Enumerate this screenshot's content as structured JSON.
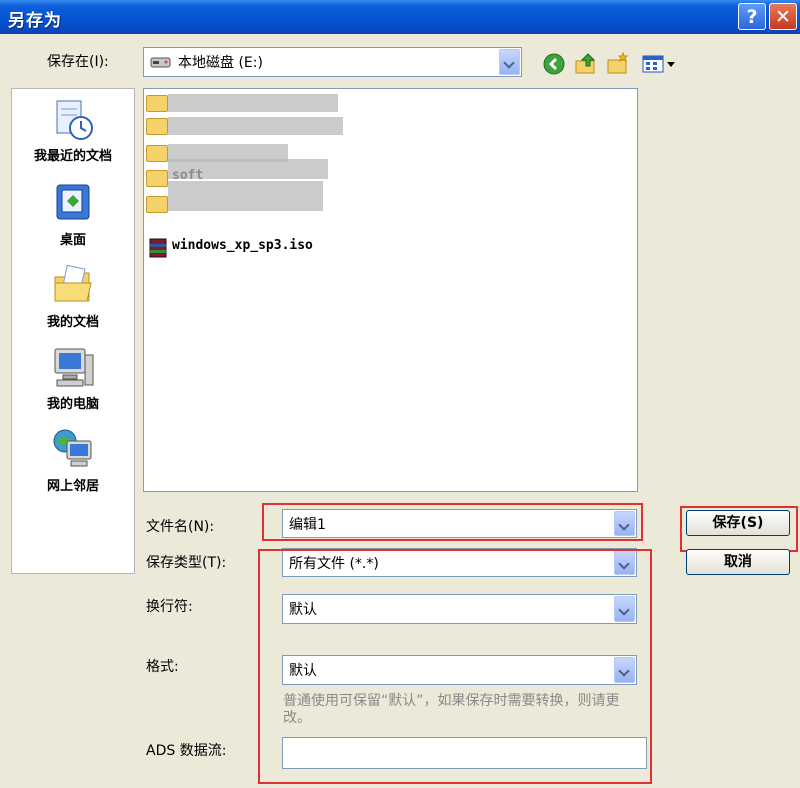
{
  "window": {
    "title": "另存为",
    "help_label": "?",
    "close_label": "✕"
  },
  "save_in": {
    "label": "保存在(I):",
    "value": "本地磁盘 (E:)"
  },
  "toolbar": {
    "icons": [
      "back-icon",
      "up-folder-icon",
      "new-folder-icon",
      "view-menu-icon"
    ]
  },
  "places": [
    {
      "label": "我最近的文档",
      "icon": "recent-documents-icon"
    },
    {
      "label": "桌面",
      "icon": "desktop-icon"
    },
    {
      "label": "我的文档",
      "icon": "my-documents-icon"
    },
    {
      "label": "我的电脑",
      "icon": "my-computer-icon"
    },
    {
      "label": "网上邻居",
      "icon": "network-places-icon"
    }
  ],
  "files": [
    {
      "name": "",
      "type": "folder"
    },
    {
      "name": "",
      "type": "folder"
    },
    {
      "name": "",
      "type": "folder"
    },
    {
      "name": "soft",
      "type": "folder"
    },
    {
      "name": "",
      "type": "folder"
    },
    {
      "name": "windows_xp_sp3.iso",
      "type": "iso"
    }
  ],
  "filename": {
    "label": "文件名(N):",
    "value": "编辑1"
  },
  "filetype": {
    "label": "保存类型(T):",
    "value": "所有文件 (*.*)"
  },
  "linebreak": {
    "label": "换行符:",
    "value": "默认"
  },
  "format": {
    "label": "格式:",
    "value": "默认"
  },
  "hint": "普通使用可保留“默认”，如果保存时需要转换，则请更改。",
  "ads": {
    "label": "ADS 数据流:",
    "value": ""
  },
  "buttons": {
    "save": "保存(S)",
    "cancel": "取消"
  },
  "colors": {
    "titlebar": "#0553d1",
    "dialog_bg": "#ece9d8",
    "highlight_box": "#e03030"
  }
}
